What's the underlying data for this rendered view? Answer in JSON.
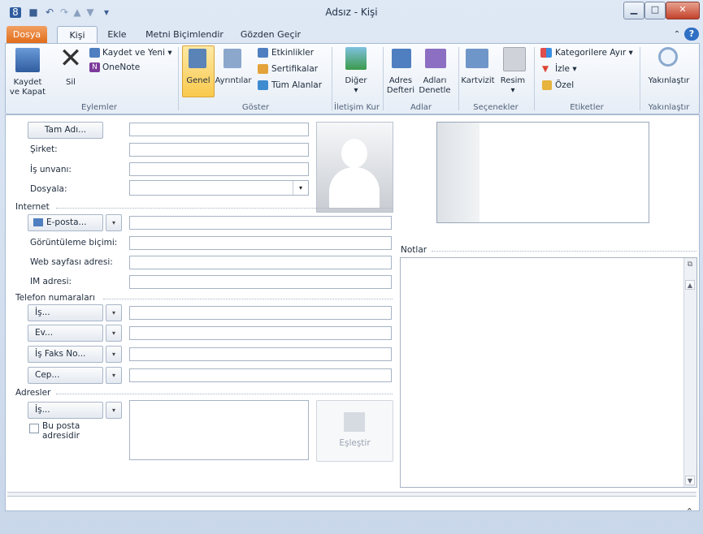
{
  "window": {
    "title": "Adsız - Kişi"
  },
  "tabs": [
    "Dosya",
    "Kişi",
    "Ekle",
    "Metni Biçimlendir",
    "Gözden Geçir"
  ],
  "ribbon": {
    "groups": {
      "actions": {
        "label": "Eylemler",
        "save_close": "Kaydet\nve Kapat",
        "delete": "Sil",
        "save_new": "Kaydet ve Yeni",
        "onenote": "OneNote"
      },
      "show": {
        "label": "Göster",
        "general": "Genel",
        "details": "Ayrıntılar",
        "activities": "Etkinlikler",
        "certificates": "Sertifikalar",
        "all_fields": "Tüm Alanlar"
      },
      "communicate": {
        "label": "İletişim Kur",
        "more": "Diğer"
      },
      "names": {
        "label": "Adlar",
        "address_book": "Adres\nDefteri",
        "check_names": "Adları\nDenetle"
      },
      "options": {
        "label": "Seçenekler",
        "business_card": "Kartvizit",
        "picture": "Resim"
      },
      "tags": {
        "label": "Etiketler",
        "categorize": "Kategorilere Ayır",
        "follow_up": "İzle",
        "private": "Özel"
      },
      "zoom": {
        "label": "Yakınlaştır",
        "zoom": "Yakınlaştır"
      }
    }
  },
  "form": {
    "full_name_button": "Tam Adı...",
    "company": "Şirket:",
    "job_title": "İş unvanı:",
    "file_as": "Dosyala:",
    "internet_section": "Internet",
    "email_button": "E-posta...",
    "display_as": "Görüntüleme biçimi:",
    "web_page": "Web sayfası adresi:",
    "im_address": "IM adresi:",
    "phones_section": "Telefon numaraları",
    "phone_buttons": [
      "İş...",
      "Ev...",
      "İş Faks No...",
      "Cep..."
    ],
    "addresses_section": "Adresler",
    "address_button": "İş...",
    "mailing_checkbox": "Bu posta\nadresidir",
    "map_button": "Eşleştir",
    "notes_section": "Notlar"
  },
  "colors": {
    "accent": "#e26c1a",
    "selected": "#fbd97a",
    "ribbon_bg": "#e6edf6"
  },
  "icons": {
    "save": "save-icon",
    "delete": "delete-x-icon",
    "picture": "contact-silhouette-icon",
    "zoom": "magnifier-icon"
  }
}
